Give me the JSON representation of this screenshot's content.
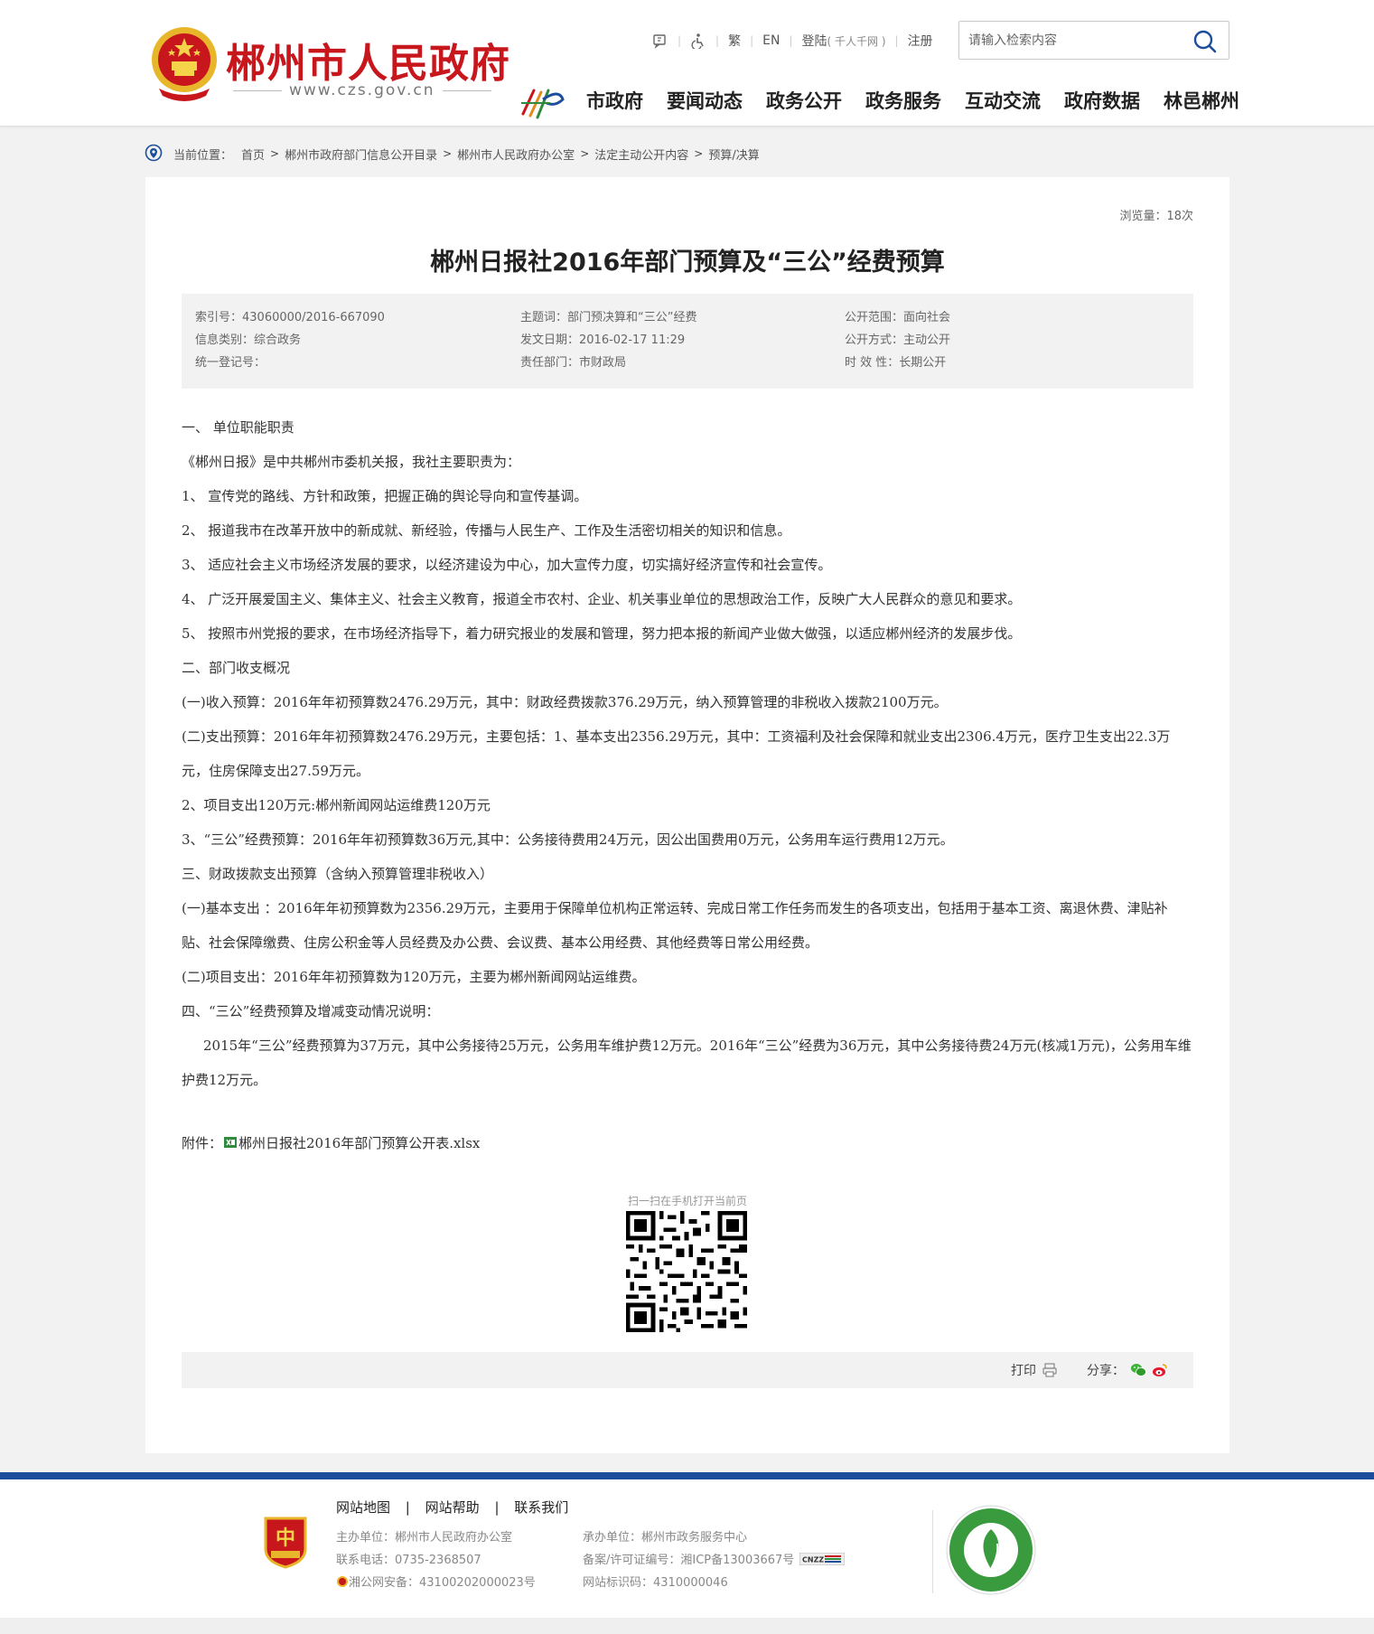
{
  "header": {
    "site_title": "郴州市人民政府",
    "site_url": "www.czs.gov.cn",
    "toplinks": {
      "traditional": "繁",
      "english": "EN",
      "login": "登陆",
      "login_sub": "( 千人千网 )",
      "register": "注册"
    },
    "search": {
      "placeholder": "请输入检索内容"
    },
    "nav": [
      "市政府",
      "要闻动态",
      "政务公开",
      "政务服务",
      "互动交流",
      "政府数据",
      "林邑郴州"
    ]
  },
  "breadcrumb": {
    "label": "当前位置：",
    "items": [
      "首页",
      "郴州市政府部门信息公开目录",
      "郴州市人民政府办公室",
      "法定主动公开内容",
      "预算/决算"
    ]
  },
  "article": {
    "views": "浏览量：18次",
    "title": "郴州日报社2016年部门预算及“三公”经费预算",
    "meta": {
      "index_no": "索引号：43060000/2016-667090",
      "category": "信息类别：综合政务",
      "reg_no": "统一登记号：",
      "topic": "主题词：部门预决算和“三公”经费",
      "date": "发文日期：2016-02-17 11:29",
      "dept": "责任部门：市财政局",
      "scope": "公开范围：面向社会",
      "method": "公开方式：主动公开",
      "validity": "时 效 性：长期公开"
    },
    "paragraphs": [
      "一、  单位职能职责",
      "《郴州日报》是中共郴州市委机关报，我社主要职责为：",
      "1、  宣传党的路线、方针和政策，把握正确的舆论导向和宣传基调。",
      "2、  报道我市在改革开放中的新成就、新经验，传播与人民生产、工作及生活密切相关的知识和信息。",
      "3、  适应社会主义市场经济发展的要求，以经济建设为中心，加大宣传力度，切实搞好经济宣传和社会宣传。",
      "4、  广泛开展爱国主义、集体主义、社会主义教育，报道全市农村、企业、机关事业单位的思想政治工作，反映广大人民群众的意见和要求。",
      "5、  按照市州党报的要求，在市场经济指导下，着力研究报业的发展和管理，努力把本报的新闻产业做大做强，以适应郴州经济的发展步伐。",
      "二、部门收支概况",
      "(一)收入预算：2016年年初预算数2476.29万元，其中：财政经费拨款376.29万元，纳入预算管理的非税收入拨款2100万元。",
      "(二)支出预算：2016年年初预算数2476.29万元，主要包括：1、基本支出2356.29万元，其中：工资福利及社会保障和就业支出2306.4万元，医疗卫生支出22.3万元，住房保障支出27.59万元。",
      "2、项目支出120万元:郴州新闻网站运维费120万元",
      "3、“三公”经费预算：2016年年初预算数36万元,其中：公务接待费用24万元，因公出国费用0万元，公务用车运行费用12万元。",
      "三、财政拨款支出预算（含纳入预算管理非税收入）",
      "(一)基本支出 ：2016年年初预算数为2356.29万元，主要用于保障单位机构正常运转、完成日常工作任务而发生的各项支出，包括用于基本工资、离退休费、津贴补贴、社会保障缴费、住房公积金等人员经费及办公费、会议费、基本公用经费、其他经费等日常公用经费。",
      "(二)项目支出：2016年年初预算数为120万元，主要为郴州新闻网站运维费。",
      "四、“三公”经费预算及增减变动情况说明：",
      "2015年“三公”经费预算为37万元，其中公务接待25万元，公务用车维护费12万元。2016年“三公”经费为36万元，其中公务接待费24万元(核减1万元)，公务用车维护费12万元。"
    ],
    "attachment_label": "附件：",
    "attachment_file": "郴州日报社2016年部门预算公开表.xlsx",
    "qr_caption": "扫一扫在手机打开当前页",
    "print_label": "打印",
    "share_label": "分享："
  },
  "footer": {
    "links": [
      "网站地图",
      "网站帮助",
      "联系我们"
    ],
    "host": "主办单位：郴州市人民政府办公室",
    "phone": "联系电话：0735-2368507",
    "police": "湘公网安备：43100202000023号",
    "undertaker": "承办单位：郴州市政务服务中心",
    "icp": "备案/许可证编号：湘ICP备13003667号",
    "site_code": "网站标识码：4310000046"
  },
  "colors": {
    "brand_red": "#c8161d",
    "footer_blue": "#1c4e9c"
  }
}
